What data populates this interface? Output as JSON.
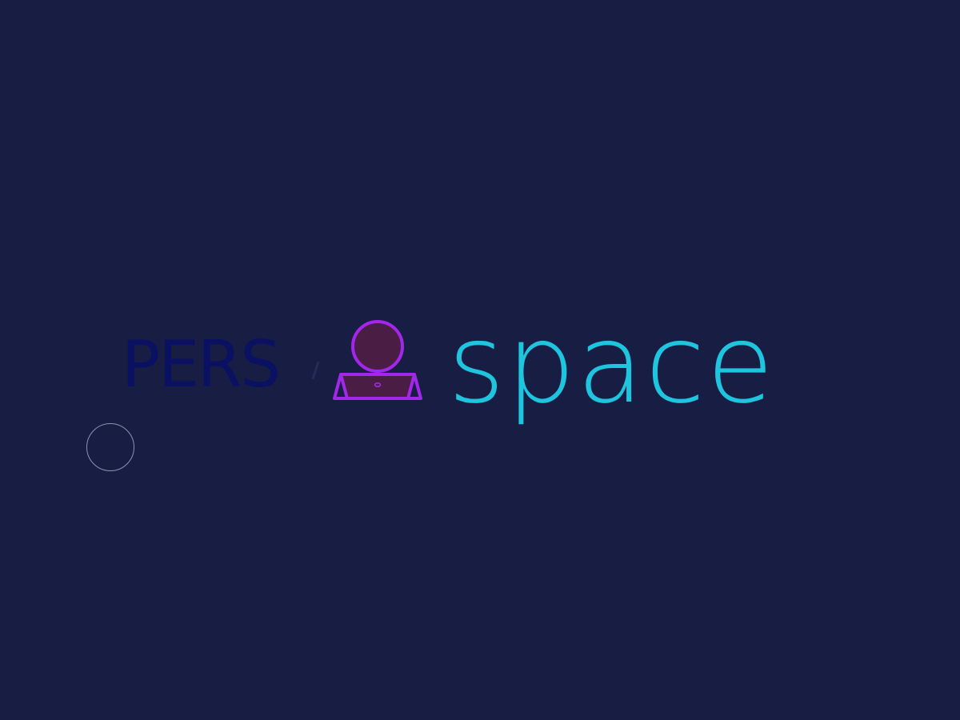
{
  "loader": {
    "partial_text": "PERS"
  },
  "logo": {
    "icon": "person-at-laptop-icon",
    "wordmark": "space",
    "colors": {
      "background": "#181d44",
      "wordmark": "#1fc4de",
      "icon_stroke": "#a327ea",
      "icon_fill": "#4a1d45",
      "loader_text": "#0a1062"
    }
  },
  "cursor": {
    "icon": "cursor-ring-icon"
  }
}
